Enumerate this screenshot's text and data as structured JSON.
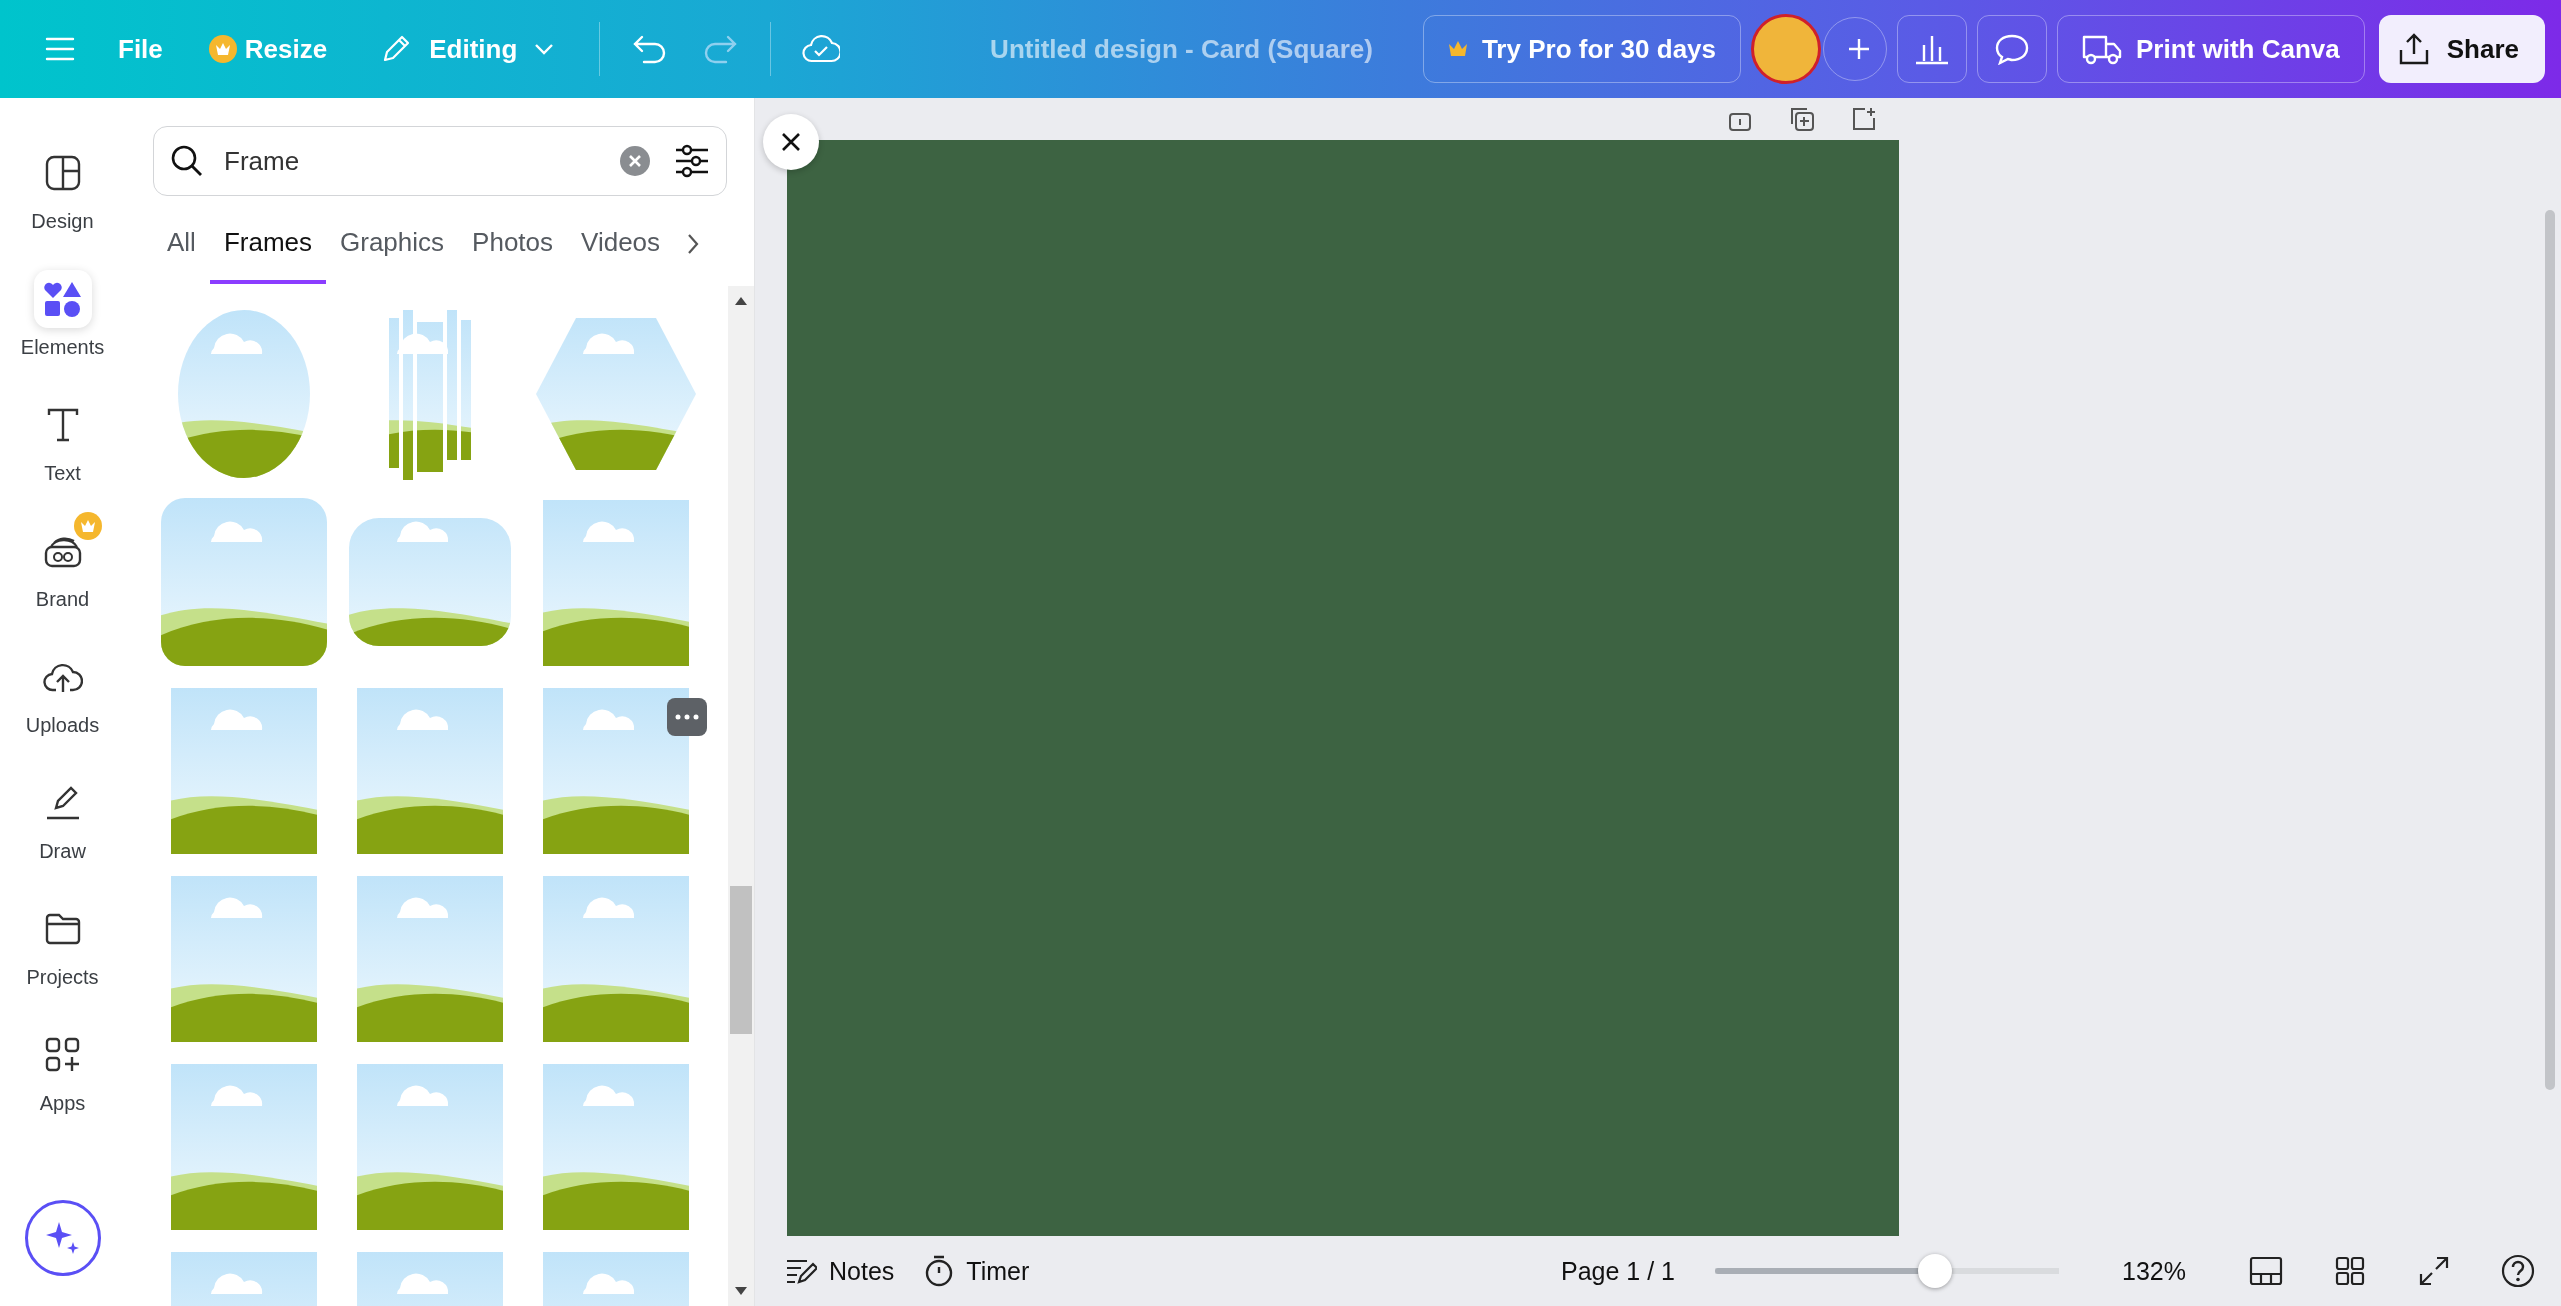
{
  "topbar": {
    "file": "File",
    "resize": "Resize",
    "editing": "Editing",
    "title": "Untitled design - Card (Square)",
    "try_pro": "Try Pro for 30 days",
    "print": "Print with Canva",
    "share": "Share"
  },
  "sidebar": {
    "items": [
      {
        "label": "Design",
        "selected": false,
        "pro": false
      },
      {
        "label": "Elements",
        "selected": true,
        "pro": false
      },
      {
        "label": "Text",
        "selected": false,
        "pro": false
      },
      {
        "label": "Brand",
        "selected": false,
        "pro": true
      },
      {
        "label": "Uploads",
        "selected": false,
        "pro": false
      },
      {
        "label": "Draw",
        "selected": false,
        "pro": false
      },
      {
        "label": "Projects",
        "selected": false,
        "pro": false
      },
      {
        "label": "Apps",
        "selected": false,
        "pro": false
      }
    ]
  },
  "panel": {
    "search": {
      "value": "Frame"
    },
    "tabs": [
      {
        "label": "All",
        "selected": false
      },
      {
        "label": "Frames",
        "selected": true
      },
      {
        "label": "Graphics",
        "selected": false
      },
      {
        "label": "Photos",
        "selected": false
      },
      {
        "label": "Videos",
        "selected": false
      }
    ]
  },
  "bottom_bar": {
    "notes": "Notes",
    "timer": "Timer",
    "page": "Page 1 / 1",
    "zoom": {
      "level": 0.64,
      "reading": "132%"
    }
  }
}
